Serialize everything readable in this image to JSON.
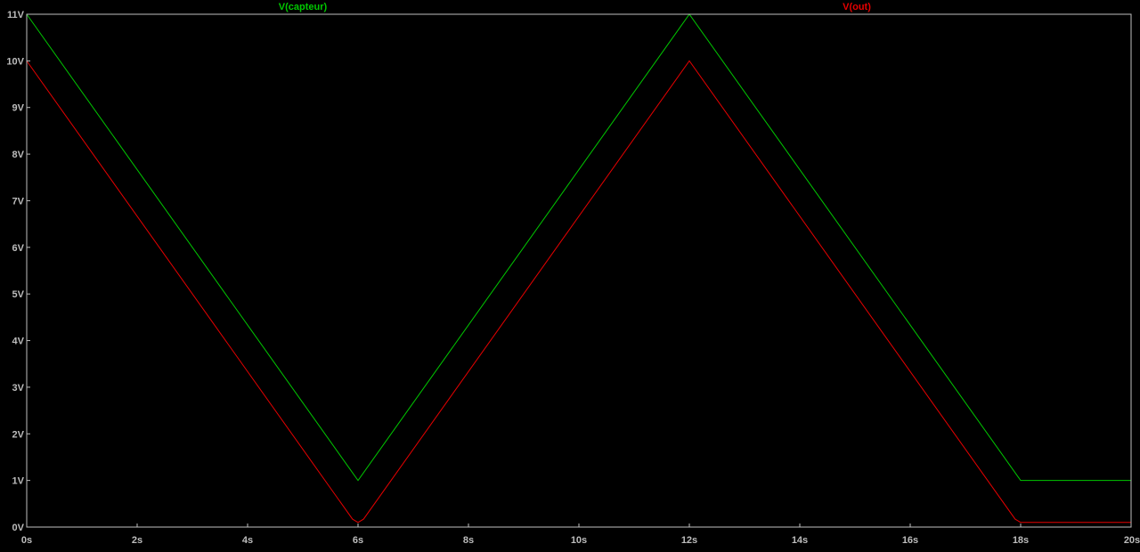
{
  "chart_data": {
    "type": "line",
    "title": "",
    "xlabel": "",
    "ylabel": "",
    "xlim": [
      0,
      20
    ],
    "ylim": [
      0,
      11
    ],
    "grid": false,
    "legend_placement": "top",
    "x_ticks": [
      "0s",
      "2s",
      "4s",
      "6s",
      "8s",
      "10s",
      "12s",
      "14s",
      "16s",
      "18s",
      "20s"
    ],
    "x_tick_values": [
      0,
      2,
      4,
      6,
      8,
      10,
      12,
      14,
      16,
      18,
      20
    ],
    "y_ticks": [
      "0V",
      "1V",
      "2V",
      "3V",
      "4V",
      "5V",
      "6V",
      "7V",
      "8V",
      "9V",
      "10V",
      "11V"
    ],
    "y_tick_values": [
      0,
      1,
      2,
      3,
      4,
      5,
      6,
      7,
      8,
      9,
      10,
      11
    ],
    "series": [
      {
        "name": "V(capteur)",
        "color": "#00c800",
        "x": [
          0,
          6,
          12,
          18,
          20
        ],
        "y": [
          11,
          1,
          11,
          1,
          1
        ]
      },
      {
        "name": "V(out)",
        "color": "#e60000",
        "x": [
          0,
          5.9,
          6.0,
          6.1,
          12,
          17.9,
          18.0,
          18.2,
          20
        ],
        "y": [
          10,
          0.17,
          0.1,
          0.17,
          10,
          0.17,
          0.1,
          0.1,
          0.1
        ]
      }
    ]
  },
  "colors": {
    "background": "#000000",
    "frame": "#c0c0c0",
    "tick_label": "#bdbdbd"
  }
}
